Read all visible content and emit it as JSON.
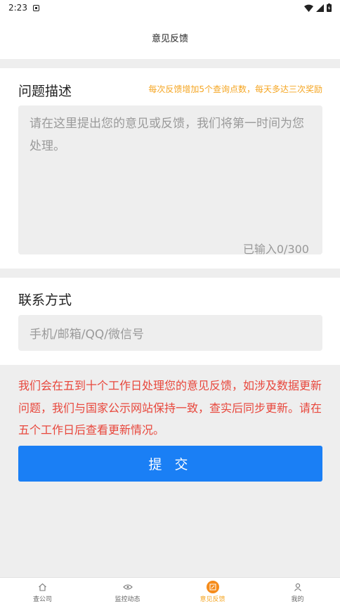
{
  "status_bar": {
    "time": "2:23"
  },
  "header": {
    "title": "意见反馈"
  },
  "problem": {
    "title": "问题描述",
    "hint": "每次反馈增加5个查询点数，每天多达三次奖励",
    "placeholder": "请在这里提出您的意见或反馈，我们将第一时间为您处理。",
    "counter": "已输入0/300"
  },
  "contact": {
    "title": "联系方式",
    "placeholder": "手机/邮箱/QQ/微信号"
  },
  "notice": "我们会在五到十个工作日处理您的意见反馈，如涉及数据更新问题，我们与国家公示网站保持一致，查实后同步更新。请在五个工作日后查看更新情况。",
  "submit_label": "提 交",
  "tabs": [
    {
      "label": "查公司",
      "icon": "home-icon"
    },
    {
      "label": "监控动态",
      "icon": "eye-icon"
    },
    {
      "label": "意见反馈",
      "icon": "edit-icon",
      "active": true
    },
    {
      "label": "我的",
      "icon": "user-icon"
    }
  ],
  "colors": {
    "accent": "#1a7ff5",
    "hint": "#f5a623",
    "notice": "#e8473c",
    "active_tab": "#f58b1a"
  }
}
